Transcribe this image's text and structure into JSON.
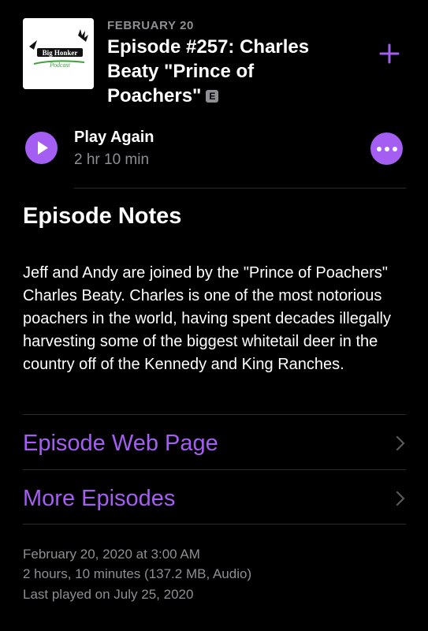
{
  "episode": {
    "date_label": "FEBRUARY 20",
    "title": "Episode #257: Charles Beaty \"Prince of Poachers\"",
    "explicit_badge": "E",
    "artwork_text_line1": "Big Honker",
    "artwork_text_line2": "Podcast"
  },
  "player": {
    "play_label": "Play Again",
    "duration": "2 hr 10 min"
  },
  "notes": {
    "heading": "Episode Notes",
    "body": "Jeff and Andy are joined by the \"Prince of Poachers\" Charles Beaty. Charles is one of the most notorious poachers in the world, having spent decades illegally harvesting some of the biggest whitetail deer in the country off of the Kennedy and King Ranches."
  },
  "links": {
    "web_page": "Episode Web Page",
    "more_episodes": "More Episodes"
  },
  "meta": {
    "published": "February 20, 2020 at 3:00 AM",
    "details": "2 hours, 10 minutes (137.2 MB, Audio)",
    "last_played": "Last played on July 25, 2020"
  },
  "colors": {
    "accent": "#a45ef2",
    "secondary_text": "#8e8e93",
    "background": "#000000"
  },
  "icons": {
    "add": "plus-icon",
    "play": "play-icon",
    "more": "ellipsis-icon",
    "chevron": "chevron-right-icon"
  }
}
